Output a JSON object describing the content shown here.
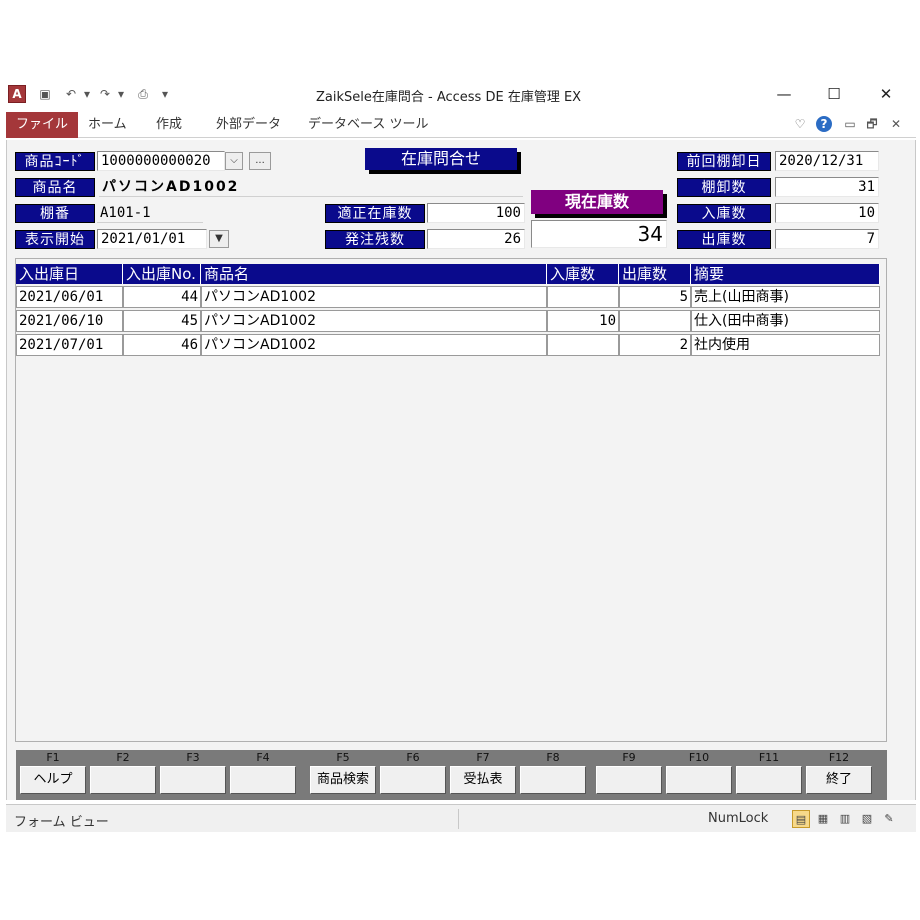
{
  "titlebar": {
    "title": "ZaikSele在庫問合 - Access DE 在庫管理 EX",
    "qa_logo": "A",
    "qa_icons": [
      "save-icon",
      "undo-icon",
      "redo-icon",
      "print-preview-icon",
      "customize-icon"
    ],
    "controls": {
      "minimize": "—",
      "maximize": "☐",
      "close": "✕"
    }
  },
  "ribbon": {
    "tabs": [
      "ファイル",
      "ホーム",
      "作成",
      "外部データ",
      "データベース ツール"
    ],
    "right_icons": {
      "collapse": "♡",
      "help": "?",
      "min": "▭",
      "restore": "🗗",
      "close": "✕"
    }
  },
  "form": {
    "title_label": "在庫問合せ",
    "product_code": {
      "label": "商品ｺｰﾄﾞ",
      "value": "1000000000020",
      "browse": "..."
    },
    "product_name": {
      "label": "商品名",
      "value": "パソコンAD1002"
    },
    "shelf": {
      "label": "棚番",
      "value": "A101-1"
    },
    "display_start": {
      "label": "表示開始",
      "value": "2021/01/01"
    },
    "proper_stock": {
      "label": "適正在庫数",
      "value": "100"
    },
    "order_remaining": {
      "label": "発注残数",
      "value": "26"
    },
    "current_stock": {
      "label": "現在庫数",
      "value": "34"
    },
    "last_inventory_date": {
      "label": "前回棚卸日",
      "value": "2020/12/31"
    },
    "inventory_count": {
      "label": "棚卸数",
      "value": "31"
    },
    "received": {
      "label": "入庫数",
      "value": "10"
    },
    "shipped": {
      "label": "出庫数",
      "value": "7"
    }
  },
  "grid": {
    "headers": [
      "入出庫日",
      "入出庫No.",
      "商品名",
      "入庫数",
      "出庫数",
      "摘要"
    ],
    "rows": [
      {
        "date": "2021/06/01",
        "no": "44",
        "name": "パソコンAD1002",
        "in": "",
        "out": "5",
        "memo": "売上(山田商事)"
      },
      {
        "date": "2021/06/10",
        "no": "45",
        "name": "パソコンAD1002",
        "in": "10",
        "out": "",
        "memo": "仕入(田中商事)"
      },
      {
        "date": "2021/07/01",
        "no": "46",
        "name": "パソコンAD1002",
        "in": "",
        "out": "2",
        "memo": "社内使用"
      }
    ]
  },
  "fkeys": [
    {
      "key": "F1",
      "label": "ヘルプ"
    },
    {
      "key": "F2",
      "label": ""
    },
    {
      "key": "F3",
      "label": ""
    },
    {
      "key": "F4",
      "label": ""
    },
    {
      "key": "F5",
      "label": "商品検索"
    },
    {
      "key": "F6",
      "label": ""
    },
    {
      "key": "F7",
      "label": "受払表"
    },
    {
      "key": "F8",
      "label": ""
    },
    {
      "key": "F9",
      "label": ""
    },
    {
      "key": "F10",
      "label": ""
    },
    {
      "key": "F11",
      "label": ""
    },
    {
      "key": "F12",
      "label": "終了"
    }
  ],
  "status": {
    "view": "フォーム ビュー",
    "numlock": "NumLock",
    "view_icons": [
      "form-view-icon",
      "datasheet-view-icon",
      "layout-view-icon",
      "design-view-icon"
    ]
  },
  "colors": {
    "label_bg": "#0a0a8c",
    "accent": "#800080",
    "file_tab": "#a4373a"
  }
}
